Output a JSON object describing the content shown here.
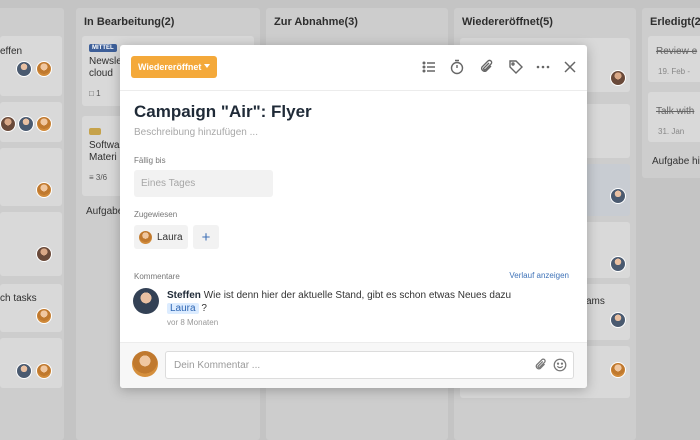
{
  "board": {
    "columns": [
      {
        "title": ""
      },
      {
        "title": "In Bearbeitung(2)"
      },
      {
        "title": "Zur Abnahme(3)"
      },
      {
        "title": "Wiedereröffnet(5)"
      },
      {
        "title": "Erledigt(2)"
      }
    ],
    "col0_cards": [
      "effen",
      "ch tasks"
    ],
    "col1_cards": {
      "tag": "MITTEL",
      "card1": [
        "Newsle",
        "cloud"
      ],
      "card1_count": "1",
      "card2": [
        "Softwa",
        "Materi"
      ],
      "card2_progress": "3/6",
      "add_task": "Aufgabe"
    },
    "col3_cards": {
      "fragment": "ams"
    },
    "col4_cards": {
      "card1_title": "Review e",
      "card1_date": "19. Feb -",
      "card2_title": "Talk with",
      "card2_date": "31. Jan",
      "add_task": "Aufgabe hi"
    }
  },
  "modal": {
    "status_label": "Wiedereröffnet",
    "title": "Campaign \"Air\": Flyer",
    "description_placeholder": "Beschreibung hinzufügen ...",
    "due_label": "Fällig bis",
    "due_placeholder": "Eines Tages",
    "assigned_label": "Zugewiesen",
    "assignee_name": "Laura",
    "add_assignee": "+",
    "comments_label": "Kommentare",
    "history_link": "Verlauf anzeigen",
    "comment": {
      "author": "Steffen",
      "text": "Wie ist denn hier der aktuelle Stand, gibt es schon etwas Neues dazu",
      "mention": "Laura",
      "suffix": "?",
      "time": "vor 8 Monaten"
    },
    "comment_placeholder": "Dein Kommentar ..."
  },
  "colors": {
    "status": "#f4a93a",
    "link": "#3f73b8",
    "mention_bg": "#dcecff"
  }
}
